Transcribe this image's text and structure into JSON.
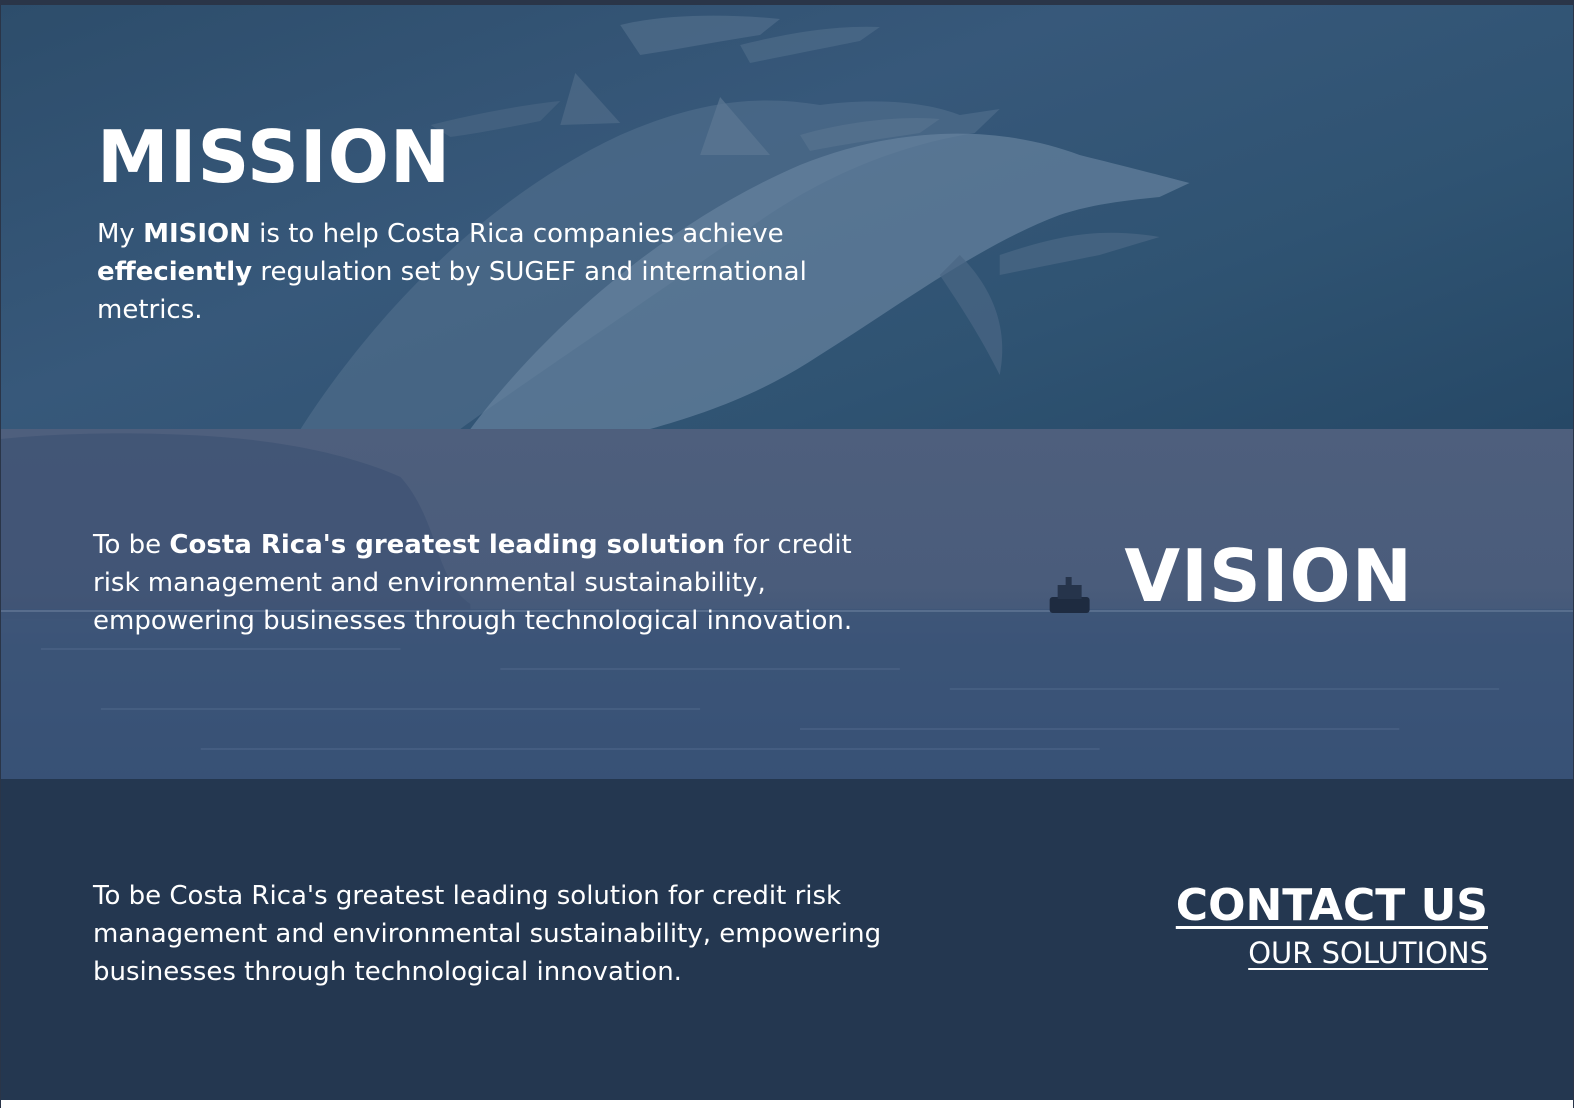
{
  "mission": {
    "title": "MISSION",
    "text_part1": "My ",
    "text_bold1": "MISION",
    "text_part2": " is to help Costa Rica companies achieve ",
    "text_bold2": "effeciently",
    "text_part3": " regulation set by SUGEF and international metrics."
  },
  "vision": {
    "title": "VISION",
    "text_part1": "To be ",
    "text_bold1": "Costa Rica's greatest leading solution",
    "text_part2": " for credit risk management and environmental sustainability, empowering businesses through technological innovation."
  },
  "footer": {
    "text": "To be Costa Rica's greatest leading solution for credit risk management and environmental sustainability, empowering businesses through technological innovation.",
    "contact_label": "CONTACT US",
    "solutions_label": "OUR SOLUTIONS"
  },
  "colors": {
    "mission_bg": "#2d4d6b",
    "vision_bg": "#4e5f7d",
    "footer_bg": "#243750",
    "text": "#ffffff"
  }
}
